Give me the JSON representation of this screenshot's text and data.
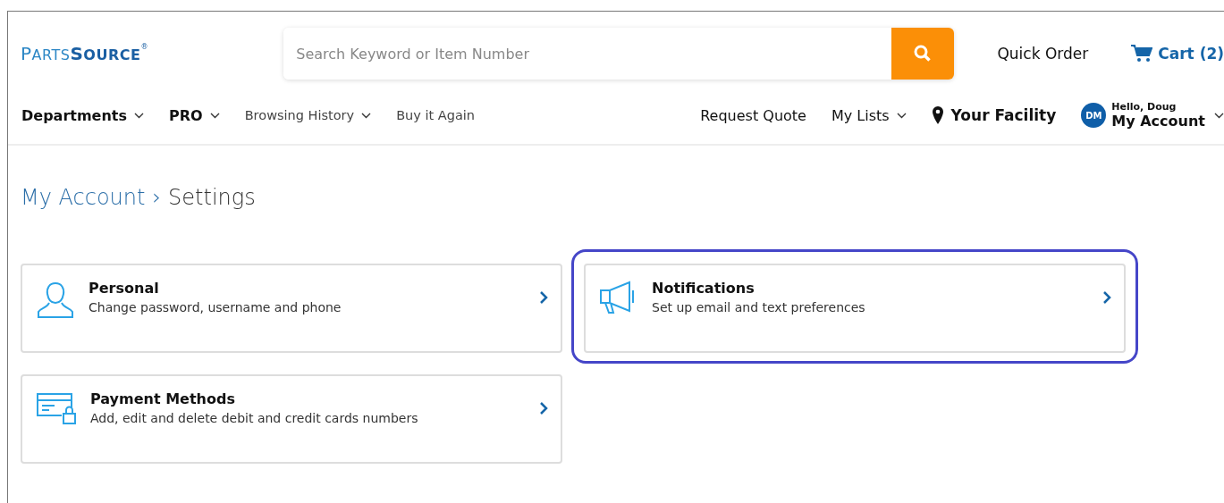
{
  "header": {
    "logo": {
      "part_1": "PARTS",
      "part_2": "SOURCE",
      "mark": "®"
    },
    "search": {
      "placeholder": "Search Keyword or Item Number"
    },
    "quick_order": "Quick Order",
    "cart": "Cart (2)"
  },
  "nav": {
    "left": [
      {
        "label": "Departments",
        "dropdown": true,
        "kind": "bold"
      },
      {
        "label": "PRO",
        "dropdown": true,
        "kind": "bold"
      },
      {
        "label": "Browsing History",
        "dropdown": true,
        "kind": "light"
      },
      {
        "label": "Buy it Again",
        "dropdown": false,
        "kind": "light"
      }
    ],
    "right": [
      {
        "label": "Request Quote",
        "dropdown": false
      },
      {
        "label": "My Lists",
        "dropdown": true
      }
    ],
    "facility": "Your Facility",
    "account": {
      "initials": "DM",
      "greeting": "Hello, Doug",
      "label": "My Account"
    }
  },
  "breadcrumb": [
    "My Account",
    "›",
    "Settings"
  ],
  "cards": [
    {
      "kind": "person",
      "title": "Personal",
      "subtitle": "Change password, username and phone",
      "highlighted": false
    },
    {
      "kind": "megaphone",
      "title": "Notifications",
      "subtitle": "Set up email and text preferences",
      "highlighted": true
    },
    {
      "kind": "card",
      "title": "Payment Methods",
      "subtitle": "Add, edit and delete debit and credit cards numbers",
      "highlighted": false
    }
  ]
}
